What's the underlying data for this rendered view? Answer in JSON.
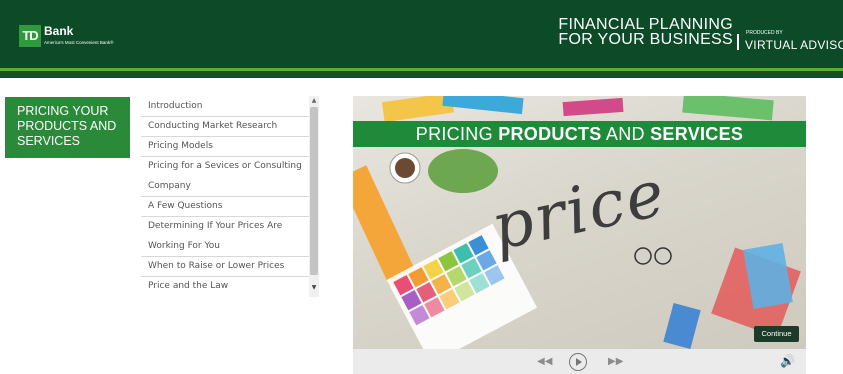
{
  "header": {
    "logo_text": "TD",
    "bank_name": "Bank",
    "tagline": "America's Most Convenient Bank®",
    "title_line1": "FINANCIAL PLANNING",
    "title_line2": "FOR YOUR BUSINESS",
    "produced_by": "PRODUCED BY",
    "producer": "VIRTUAL ADVISOR"
  },
  "section_badge": {
    "line1": "PRICING YOUR",
    "line2": "PRODUCTS AND",
    "line3": "SERVICES"
  },
  "toc": {
    "items": [
      "Introduction",
      "Conducting Market Research",
      "Pricing Models",
      "Pricing for a Sevices or Consulting",
      "Company",
      "A Few Questions",
      "Determining If Your Prices Are",
      "Working For You",
      "When to Raise or Lower Prices",
      "Price and the Law"
    ]
  },
  "video": {
    "title_light_1": "PRICING ",
    "title_bold_1": "PRODUCTS",
    "title_light_2": " AND ",
    "title_bold_2": "SERVICES",
    "image_word": "price",
    "continue_label": "Continue"
  },
  "colors": {
    "header_green": "#0c4a28",
    "accent_green": "#2a8a3a",
    "light_green_line": "#5fae2e"
  }
}
